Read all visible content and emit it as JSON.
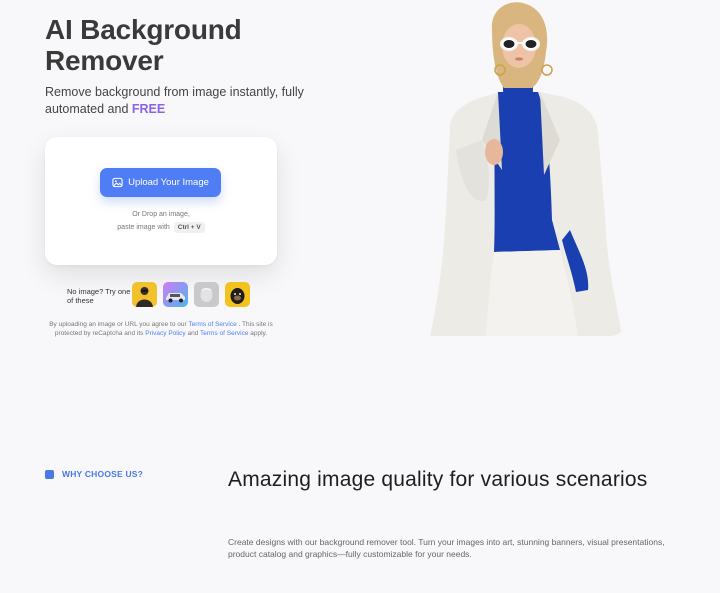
{
  "hero": {
    "title": "AI Background Remover",
    "subtitle_main": "Remove background from image instantly, fully automated and ",
    "subtitle_free": "FREE"
  },
  "upload": {
    "button_label": "Upload Your Image",
    "drop_line1": "Or Drop an image,",
    "drop_line2": "paste image with",
    "shortcut": "Ctrl + V"
  },
  "samples": {
    "label": "No image? Try one of these",
    "items": [
      "sample-person-yellow",
      "sample-car",
      "sample-product",
      "sample-dog"
    ]
  },
  "terms": {
    "p1": "By uploading an image or URL you agree to our ",
    "link1": "Terms of Service",
    "p2": " . This site is protected by reCaptcha and its ",
    "link2": "Privacy Policy",
    "p3": " and ",
    "link3": "Terms of Service",
    "p4": " apply."
  },
  "why": {
    "badge": "WHY CHOOSE US?",
    "title": "Amazing image quality for various scenarios",
    "description": "Create designs with our background remover tool. Turn your images into art, stunning banners, visual presentations, product catalog and graphics—fully customizable for your needs."
  },
  "colors": {
    "accent": "#4f7df5",
    "free": "#8a63e6",
    "sweater": "#1a3fb0",
    "blazer": "#ecebe6"
  }
}
